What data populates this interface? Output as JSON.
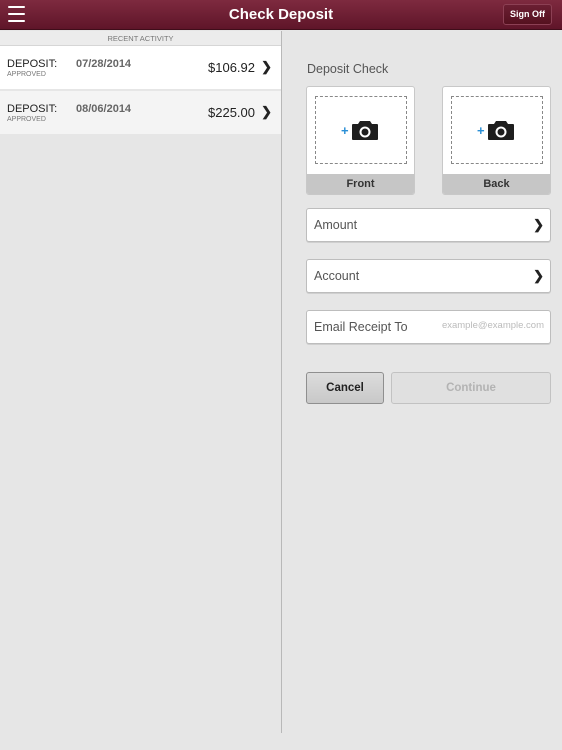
{
  "header": {
    "title": "Check Deposit",
    "sign_off_label": "Sign Off",
    "menu_icon": "hamburger-menu-icon",
    "bg_color": "#6e1f35"
  },
  "recent_activity": {
    "header": "RECENT ACTIVITY",
    "items": [
      {
        "type": "DEPOSIT:",
        "status": "APPROVED",
        "date": "07/28/2014",
        "amount": "$106.92"
      },
      {
        "type": "DEPOSIT:",
        "status": "APPROVED",
        "date": "08/06/2014",
        "amount": "$225.00"
      }
    ]
  },
  "deposit": {
    "title": "Deposit Check",
    "front_label": "Front",
    "back_label": "Back",
    "camera_icon": "camera-add-icon",
    "amount_label": "Amount",
    "account_label": "Account",
    "email_label": "Email Receipt To",
    "email_placeholder": "example@example.com",
    "email_value": "",
    "cancel_label": "Cancel",
    "continue_label": "Continue",
    "accent_color": "#2a8fd6"
  }
}
